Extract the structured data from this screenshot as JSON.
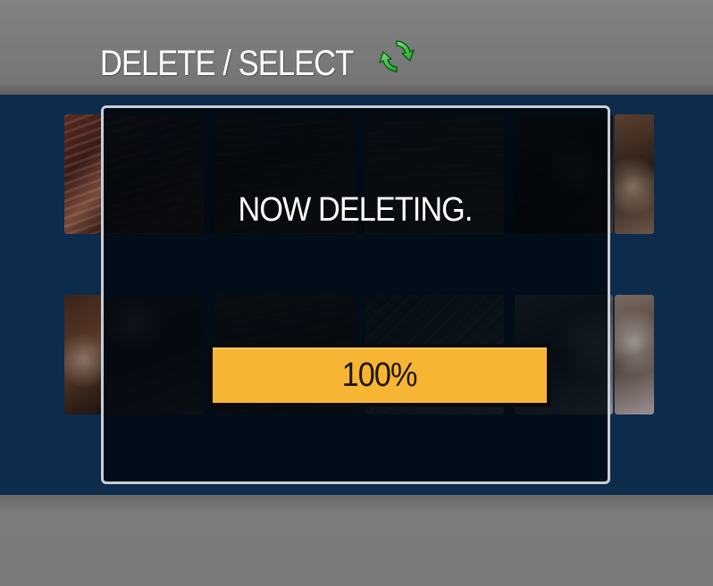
{
  "header": {
    "title": "DELETE / SELECT",
    "icon": "refresh-icon",
    "icon_color": "#2fc23a"
  },
  "dialog": {
    "status_text": "NOW DELETING.",
    "progress": {
      "value_percent": 100,
      "label": "100%",
      "fill_color": "#f7b534"
    }
  },
  "colors": {
    "background_gray": "#7b7b7b",
    "content_blue": "#0d2b4b",
    "dialog_border": "#c9ced6"
  },
  "thumbnails": [
    {
      "id": "thumb-r1-c0",
      "selected": false
    },
    {
      "id": "thumb-r1-c1",
      "selected": false
    },
    {
      "id": "thumb-r1-c2",
      "selected": false
    },
    {
      "id": "thumb-r1-c3",
      "selected": false
    },
    {
      "id": "thumb-r1-c4",
      "selected": false
    },
    {
      "id": "thumb-r1-c5",
      "selected": false
    },
    {
      "id": "thumb-r2-c0",
      "selected": false
    },
    {
      "id": "thumb-r2-c1",
      "selected": false
    },
    {
      "id": "thumb-r2-c2",
      "selected": false
    },
    {
      "id": "thumb-r2-c3",
      "selected": false
    },
    {
      "id": "thumb-r2-c4",
      "selected": false
    },
    {
      "id": "thumb-r2-c5",
      "selected": false
    }
  ]
}
